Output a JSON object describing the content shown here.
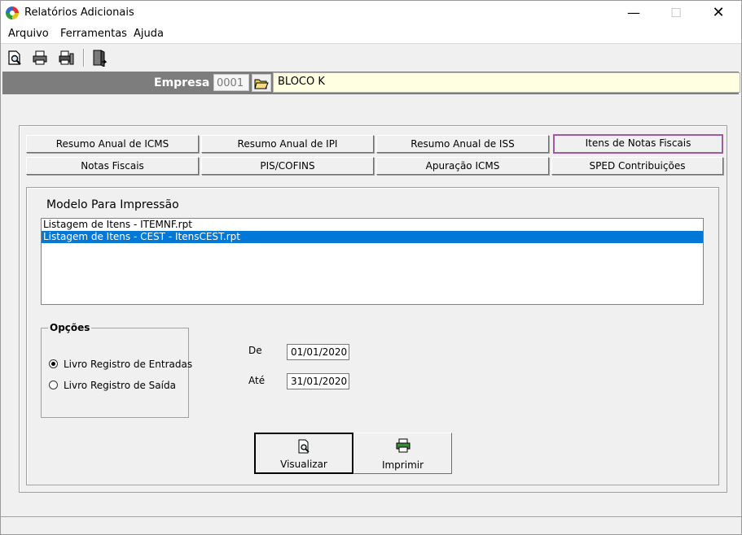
{
  "window": {
    "title": "Relatórios Adicionais",
    "min_glyph": "—",
    "max_glyph": "☐",
    "close_glyph": "✕"
  },
  "menu": [
    "Arquivo",
    "Ferramentas",
    "Ajuda"
  ],
  "toolbar": [
    "preview-icon",
    "print-icon",
    "print-setup-icon",
    "exit-door-icon"
  ],
  "empresa": {
    "label": "Empresa",
    "code": "0001",
    "name": "BLOCO K"
  },
  "tabs": {
    "row1": [
      "Resumo Anual de ICMS",
      "Resumo Anual de IPI",
      "Resumo Anual de ISS",
      "Itens de Notas Fiscais"
    ],
    "row2": [
      "Notas Fiscais",
      "PIS/COFINS",
      "Apuração ICMS",
      "SPED Contribuições"
    ],
    "active": "Itens de Notas Fiscais"
  },
  "modelo": {
    "title": "Modelo Para Impressão",
    "items": [
      "Listagem de Itens - ITEMNF.rpt",
      "Listagem de Itens - CEST - ItensCEST.rpt"
    ],
    "selected_index": 1
  },
  "opcoes": {
    "title": "Opções",
    "options": [
      "Livro Registro de Entradas",
      "Livro Registro de Saída"
    ],
    "selected": "Livro Registro de Entradas"
  },
  "dates": {
    "de_label": "De",
    "de_value": "01/01/2020",
    "ate_label": "Até",
    "ate_value": "31/01/2020"
  },
  "actions": {
    "visualizar": "Visualizar",
    "imprimir": "Imprimir"
  },
  "colors": {
    "selection": "#0078d7",
    "active_tab_border": "#a05aa0",
    "empresa_bar": "#7d7d7d",
    "empresa_name_bg": "#ffffe1"
  }
}
